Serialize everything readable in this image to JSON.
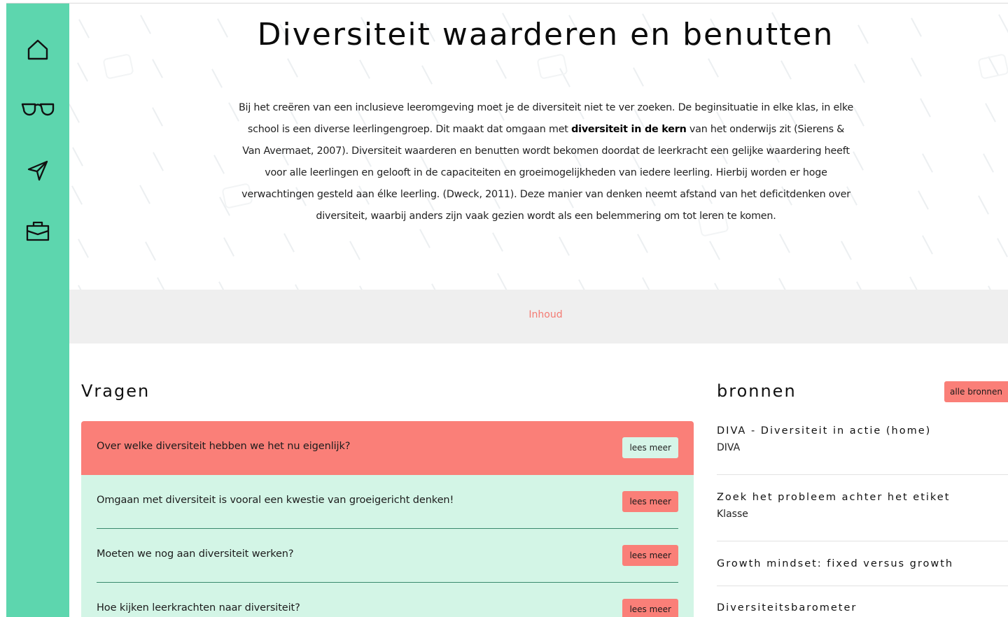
{
  "page": {
    "title": "Diversiteit waarderen en benutten",
    "intro": {
      "part1": "Bij het creëren van een inclusieve leeromgeving moet je de diversiteit niet te ver zoeken. De beginsituatie in elke klas, in elke school is een diverse leerlingengroep. Dit maakt dat omgaan met ",
      "bold": "diversiteit in de kern",
      "part2": " van het onderwijs zit (Sierens & Van Avermaet, 2007).   Diversiteit waarderen en benutten wordt bekomen doordat de leerkracht een gelijke waardering heeft voor alle leerlingen en gelooft in de capaciteiten en groeimogelijkheden van iedere leerling. Hierbij worden er hoge verwachtingen gesteld aan élke leerling.  (Dweck, 2011). Deze manier van denken neemt afstand van het deficitdenken over diversiteit, waarbij anders zijn vaak gezien wordt als een belemmering om tot leren te komen."
    },
    "band_link": "Inhoud"
  },
  "sidebar": {
    "items": [
      {
        "icon": "home-icon"
      },
      {
        "icon": "glasses-icon"
      },
      {
        "icon": "paper-plane-icon"
      },
      {
        "icon": "briefcase-icon"
      }
    ]
  },
  "vragen": {
    "title": "Vragen",
    "button_label": "lees meer",
    "items": [
      {
        "text": "Over welke diversiteit hebben we het nu eigenlijk?"
      },
      {
        "text": "Omgaan met diversiteit is vooral een kwestie van groeigericht denken!"
      },
      {
        "text": "Moeten we nog aan diversiteit werken?"
      },
      {
        "text": "Hoe kijken leerkrachten naar diversiteit?"
      }
    ]
  },
  "bronnen": {
    "title": "bronnen",
    "all_button": "alle bronnen",
    "items": [
      {
        "title": "DIVA - Diversiteit in actie (home)",
        "sub": "DIVA"
      },
      {
        "title": "Zoek het probleem achter het etiket",
        "sub": "Klasse"
      },
      {
        "title": "Growth mindset: fixed versus growth",
        "sub": ""
      },
      {
        "title": "Diversiteitsbarometer",
        "sub": ""
      }
    ]
  },
  "colors": {
    "sidebar": "#5dd6ae",
    "accent": "#fa7f78",
    "question_bg": "#d3f5e6",
    "link": "#f47b73"
  }
}
